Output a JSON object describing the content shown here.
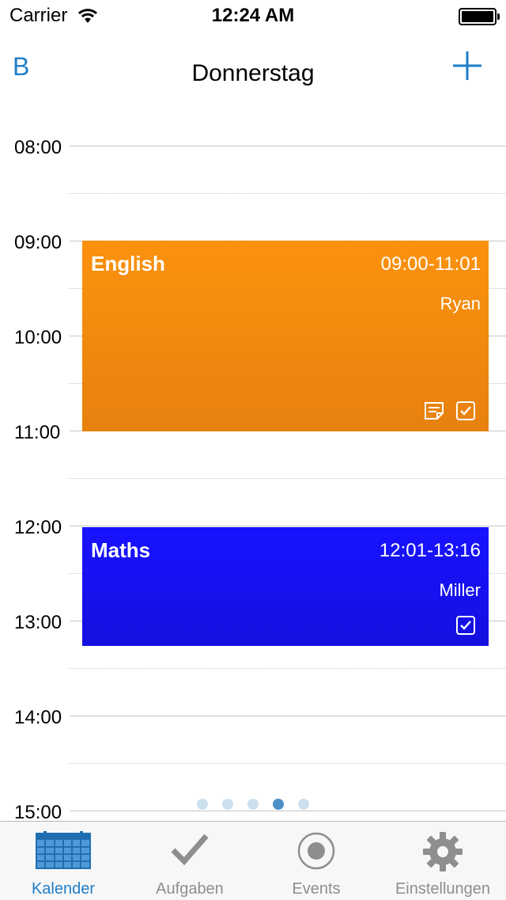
{
  "status_bar": {
    "carrier": "Carrier",
    "time": "12:24 AM"
  },
  "nav": {
    "left_button": "B",
    "title": "Donnerstag"
  },
  "timeline": {
    "hours": [
      "08:00",
      "09:00",
      "10:00",
      "11:00",
      "12:00",
      "13:00",
      "14:00",
      "15:00"
    ]
  },
  "events": [
    {
      "name": "English",
      "time": "09:00-11:01",
      "teacher": "Ryan",
      "color": "#f98d0f",
      "icons": [
        "note-icon",
        "checkbox-icon"
      ]
    },
    {
      "name": "Maths",
      "time": "12:01-13:16",
      "teacher": "Miller",
      "color": "#1811f4",
      "icons": [
        "checkbox-icon"
      ]
    }
  ],
  "page_indicator": {
    "count": 5,
    "active_index": 3
  },
  "tabs": [
    {
      "label": "Kalender",
      "icon": "calendar-icon",
      "active": true
    },
    {
      "label": "Aufgaben",
      "icon": "checkmark-icon",
      "active": false
    },
    {
      "label": "Events",
      "icon": "record-icon",
      "active": false
    },
    {
      "label": "Einstellungen",
      "icon": "gear-icon",
      "active": false
    }
  ],
  "colors": {
    "accent": "#1f7ec8",
    "inactive_tab": "#8e8e8e"
  }
}
